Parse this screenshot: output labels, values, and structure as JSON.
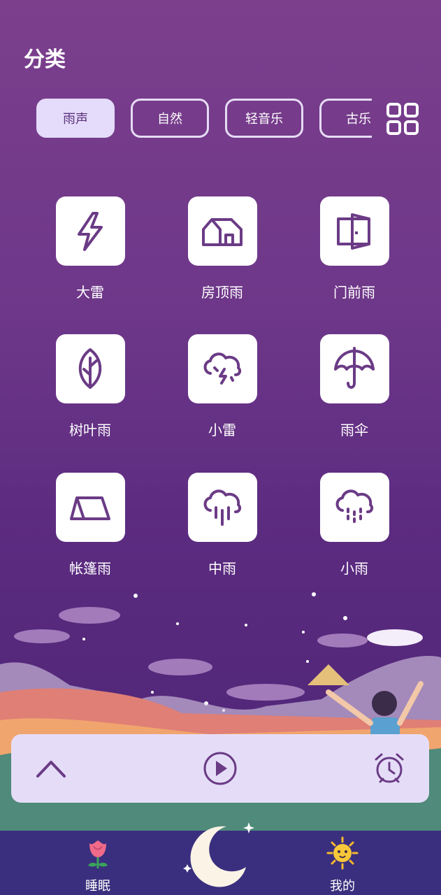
{
  "header": {
    "title": "分类"
  },
  "categories": [
    {
      "label": "雨声",
      "active": true
    },
    {
      "label": "自然",
      "active": false
    },
    {
      "label": "轻音乐",
      "active": false
    },
    {
      "label": "古乐",
      "active": false
    }
  ],
  "sounds": [
    {
      "label": "大雷",
      "icon": "lightning-icon"
    },
    {
      "label": "房顶雨",
      "icon": "roof-icon"
    },
    {
      "label": "门前雨",
      "icon": "door-icon"
    },
    {
      "label": "树叶雨",
      "icon": "leaf-icon"
    },
    {
      "label": "小雷",
      "icon": "thunder-cloud-icon"
    },
    {
      "label": "雨伞",
      "icon": "umbrella-icon"
    },
    {
      "label": "帐篷雨",
      "icon": "tent-icon"
    },
    {
      "label": "中雨",
      "icon": "rain-cloud-icon"
    },
    {
      "label": "小雨",
      "icon": "drizzle-cloud-icon"
    }
  ],
  "tabbar": {
    "left_label": "睡眠",
    "right_label": "我的"
  },
  "colors": {
    "accent": "#6b3b86",
    "chip_active_bg": "#e4dcfa",
    "tabbar_bg": "#3a2f7e"
  }
}
